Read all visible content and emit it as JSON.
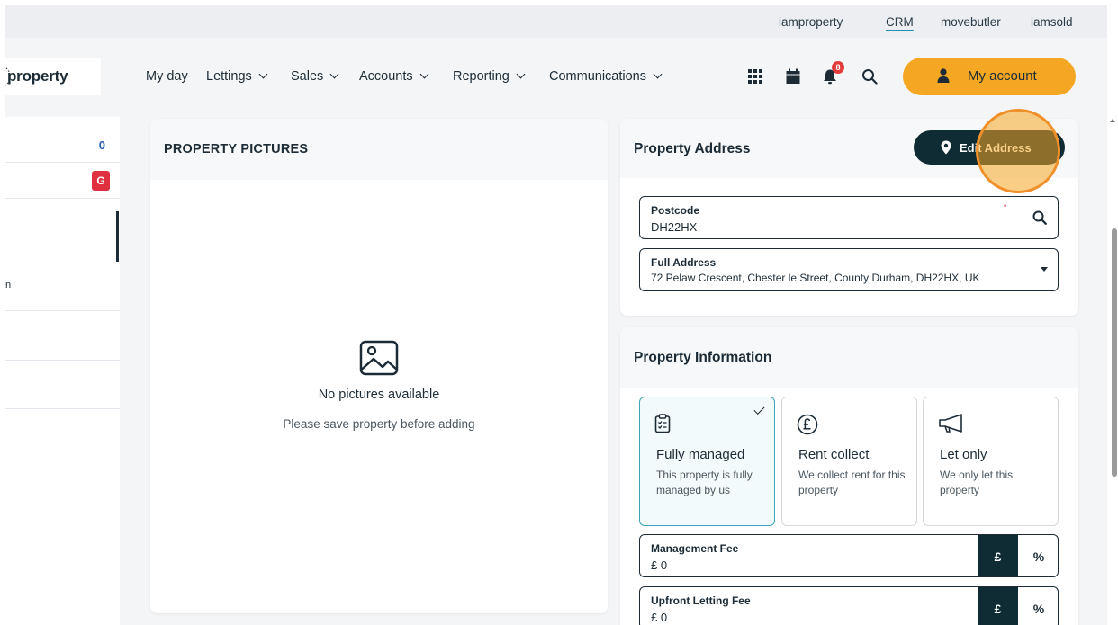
{
  "brands": [
    "iamproperty",
    "CRM",
    "movebutler",
    "iamsold"
  ],
  "brand_active": "CRM",
  "logo_text": "property",
  "nav": {
    "items": [
      "My day",
      "Lettings",
      "Sales",
      "Accounts",
      "Reporting",
      "Communications"
    ],
    "notifications_count": "8",
    "account_label": "My account"
  },
  "sidebar": {
    "count": "0",
    "badge_letter": "G",
    "row_fragment": "n"
  },
  "pictures": {
    "title": "PROPERTY PICTURES",
    "empty_title": "No pictures available",
    "empty_subtitle": "Please save property before adding"
  },
  "address": {
    "title": "Property Address",
    "edit_button": "Edit Address",
    "postcode_label": "Postcode",
    "postcode_value": "DH22HX",
    "full_address_label": "Full Address",
    "full_address_value": "72 Pelaw Crescent, Chester le Street, County Durham, DH22HX, UK"
  },
  "info": {
    "title": "Property Information",
    "options": [
      {
        "title": "Fully managed",
        "desc": "This property is fully managed by us",
        "selected": true
      },
      {
        "title": "Rent collect",
        "desc": "We collect rent for this property",
        "selected": false
      },
      {
        "title": "Let only",
        "desc": "We only let this property",
        "selected": false
      }
    ],
    "fees": [
      {
        "label": "Management Fee",
        "value": "£ 0"
      },
      {
        "label": "Upfront Letting Fee",
        "value": "£ 0"
      }
    ],
    "currency_symbol": "£",
    "percent_symbol": "%"
  },
  "colors": {
    "accent": "#f5a623",
    "dark": "#0f2c35",
    "selected_border": "#3ea6b8",
    "badge_red": "#e02f3f"
  }
}
